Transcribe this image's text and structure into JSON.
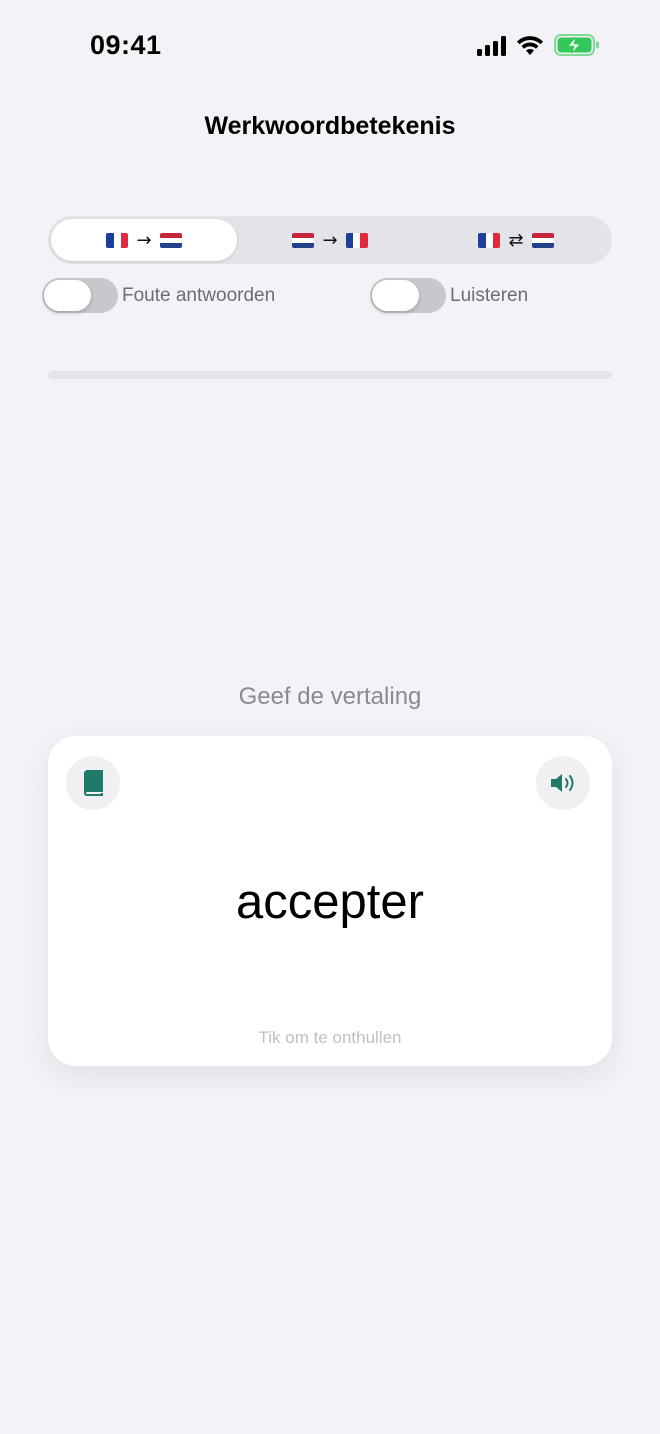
{
  "status_bar": {
    "time": "09:41",
    "icons": [
      "cellular-signal-icon",
      "wifi-icon",
      "battery-charging-icon"
    ],
    "battery_color": "#34c759"
  },
  "header": {
    "title": "Werkwoordbetekenis"
  },
  "direction_selector": {
    "selected_index": 0,
    "options": [
      {
        "from": "flag-fr-icon",
        "arrow": "→",
        "to": "flag-nl-icon"
      },
      {
        "from": "flag-nl-icon",
        "arrow": "→",
        "to": "flag-fr-icon"
      },
      {
        "from": "flag-fr-icon",
        "arrow": "⇄",
        "to": "flag-nl-icon"
      }
    ]
  },
  "toggles": {
    "wrong_answers": {
      "label": "Foute antwoorden",
      "on": false
    },
    "listen": {
      "label": "Luisteren",
      "on": false
    }
  },
  "progress": {
    "fraction": 0
  },
  "prompt": "Geef de vertaling",
  "card": {
    "word": "accepter",
    "hint": "Tik om te onthullen",
    "left_icon": "book-icon",
    "right_icon": "speaker-icon",
    "icon_color": "#1f7a6a"
  }
}
